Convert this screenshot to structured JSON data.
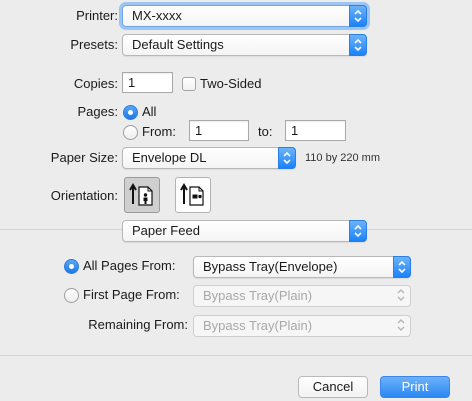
{
  "printer": {
    "label": "Printer:",
    "value": "MX-xxxx"
  },
  "presets": {
    "label": "Presets:",
    "value": "Default Settings"
  },
  "copies": {
    "label": "Copies:",
    "value": "1",
    "two_sided_label": "Two-Sided"
  },
  "pages": {
    "label": "Pages:",
    "all_label": "All",
    "from_label": "From:",
    "from_value": "1",
    "to_label": "to:",
    "to_value": "1"
  },
  "paper_size": {
    "label": "Paper Size:",
    "value": "Envelope DL",
    "dimensions": "110 by 220 mm"
  },
  "orientation": {
    "label": "Orientation:",
    "options": [
      "portrait-icon",
      "landscape-icon"
    ],
    "selected": "portrait"
  },
  "section": {
    "value": "Paper Feed"
  },
  "paper_feed": {
    "all_pages_label": "All Pages From:",
    "all_pages_value": "Bypass Tray(Envelope)",
    "first_page_label": "First Page From:",
    "first_page_value": "Bypass Tray(Plain)",
    "remaining_label": "Remaining From:",
    "remaining_value": "Bypass Tray(Plain)"
  },
  "buttons": {
    "cancel": "Cancel",
    "print": "Print"
  },
  "colors": {
    "accent": "#2c88f4",
    "window": "#ececec"
  }
}
